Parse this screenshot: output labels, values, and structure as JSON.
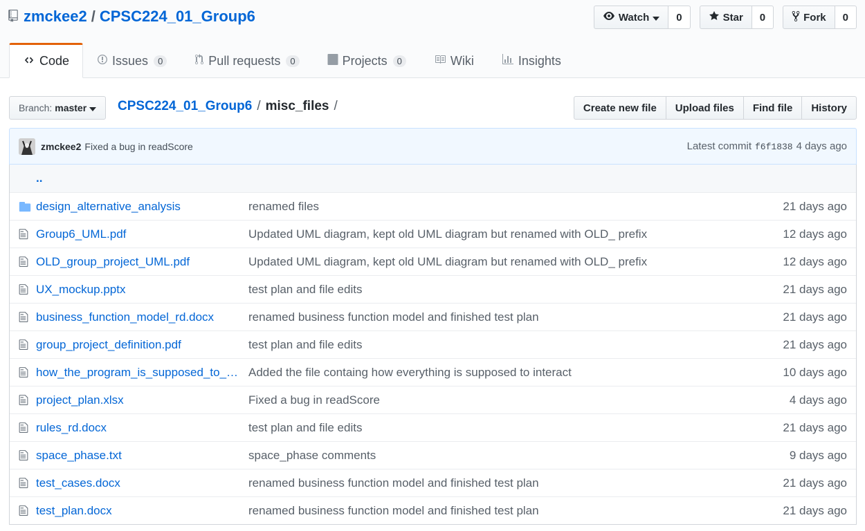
{
  "repo": {
    "owner": "zmckee2",
    "separator": "/",
    "name": "CPSC224_01_Group6"
  },
  "actions": [
    {
      "name": "watch",
      "label": "Watch",
      "count": "0",
      "icon": "eye-icon"
    },
    {
      "name": "star",
      "label": "Star",
      "count": "0",
      "icon": "star-icon"
    },
    {
      "name": "fork",
      "label": "Fork",
      "count": "0",
      "icon": "fork-icon"
    }
  ],
  "nav": [
    {
      "label": "Code",
      "counter": "",
      "icon": "code-icon",
      "selected": true
    },
    {
      "label": "Issues",
      "counter": "0",
      "icon": "issue-icon"
    },
    {
      "label": "Pull requests",
      "counter": "0",
      "icon": "pull-request-icon"
    },
    {
      "label": "Projects",
      "counter": "0",
      "icon": "project-icon"
    },
    {
      "label": "Wiki",
      "counter": "",
      "icon": "book-icon"
    },
    {
      "label": "Insights",
      "counter": "",
      "icon": "graph-icon"
    }
  ],
  "branch": {
    "label": "Branch:",
    "value": "master"
  },
  "breadcrumb": {
    "root": "CPSC224_01_Group6",
    "sep": "/",
    "folder": "misc_files",
    "trailing": "/"
  },
  "file_actions": [
    "Create new file",
    "Upload files",
    "Find file",
    "History"
  ],
  "commit": {
    "author": "zmckee2",
    "message": "Fixed a bug in readScore",
    "latest_label": "Latest commit",
    "sha": "f6f1838",
    "age": "4 days ago"
  },
  "up_tree": "..",
  "files": [
    {
      "type": "dir",
      "name": "design_alternative_analysis",
      "message": "renamed files",
      "age": "21 days ago"
    },
    {
      "type": "file",
      "name": "Group6_UML.pdf",
      "message": "Updated UML diagram, kept old UML diagram but renamed with OLD_ prefix",
      "age": "12 days ago"
    },
    {
      "type": "file",
      "name": "OLD_group_project_UML.pdf",
      "message": "Updated UML diagram, kept old UML diagram but renamed with OLD_ prefix",
      "age": "12 days ago"
    },
    {
      "type": "file",
      "name": "UX_mockup.pptx",
      "message": "test plan and file edits",
      "age": "21 days ago"
    },
    {
      "type": "file",
      "name": "business_function_model_rd.docx",
      "message": "renamed business function model and finished test plan",
      "age": "21 days ago"
    },
    {
      "type": "file",
      "name": "group_project_definition.pdf",
      "message": "test plan and file edits",
      "age": "21 days ago"
    },
    {
      "type": "file",
      "name": "how_the_program_is_supposed_to_…",
      "message": "Added the file containg how everything is supposed to interact",
      "age": "10 days ago"
    },
    {
      "type": "file",
      "name": "project_plan.xlsx",
      "message": "Fixed a bug in readScore",
      "age": "4 days ago"
    },
    {
      "type": "file",
      "name": "rules_rd.docx",
      "message": "test plan and file edits",
      "age": "21 days ago"
    },
    {
      "type": "file",
      "name": "space_phase.txt",
      "message": "space_phase comments",
      "age": "9 days ago"
    },
    {
      "type": "file",
      "name": "test_cases.docx",
      "message": "renamed business function model and finished test plan",
      "age": "21 days ago"
    },
    {
      "type": "file",
      "name": "test_plan.docx",
      "message": "renamed business function model and finished test plan",
      "age": "21 days ago"
    }
  ]
}
